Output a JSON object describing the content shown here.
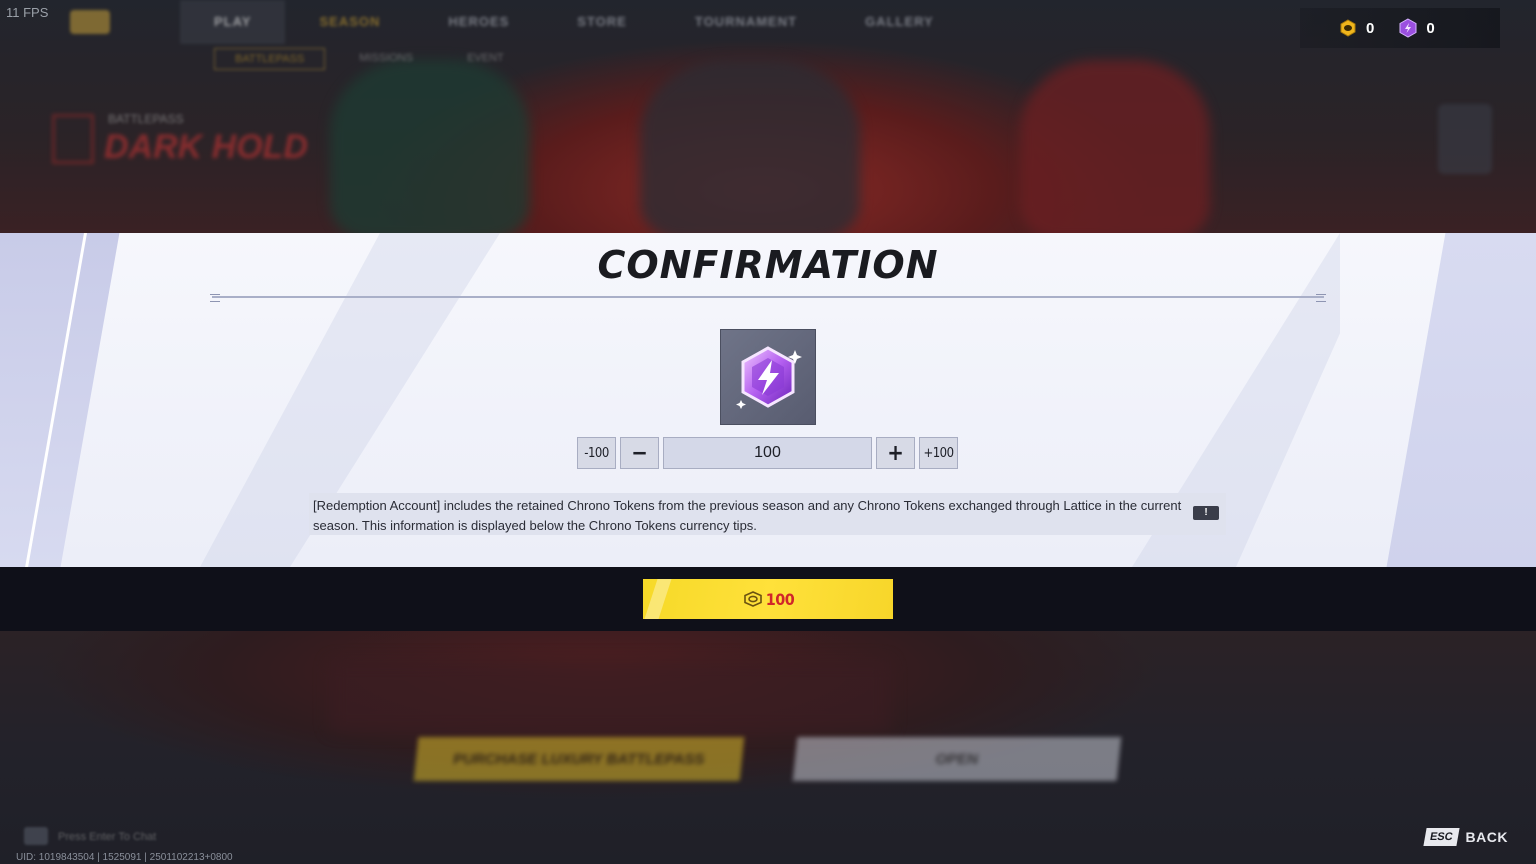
{
  "fps": "11 FPS",
  "background": {
    "nav_tabs": [
      "PLAY",
      "SEASON",
      "HEROES",
      "STORE",
      "TOURNAMENT",
      "GALLERY"
    ],
    "sub_tabs": [
      "BATTLEPASS",
      "MISSIONS",
      "EVENT"
    ],
    "battlepass_label": "BATTLEPASS",
    "battlepass_title": "DARK HOLD",
    "purchase_button": "PURCHASE LUXURY BATTLEPASS",
    "open_button": "OPEN",
    "press_enter": "Press Enter To Chat"
  },
  "currency": {
    "gold_amount": "0",
    "chrono_amount": "0"
  },
  "modal": {
    "title": "CONFIRMATION",
    "item_icon": "chrono-token-icon",
    "quantity": {
      "minus_100": "-100",
      "minus": "−",
      "value": "100",
      "plus": "+",
      "plus_100": "+100"
    },
    "info_text": "[Redemption Account] includes the retained Chrono Tokens from the previous season and any Chrono Tokens exchanged through Lattice in the current season. This information is displayed below the Chrono Tokens currency tips.",
    "info_icon": "!"
  },
  "confirm": {
    "price": "100",
    "price_color": "#d0262a",
    "button_color": "#ffe13a"
  },
  "footer": {
    "uid": "UID: 1019843504 | 1525091 | 2501102213+0800",
    "esc_key": "ESC",
    "back_label": "BACK"
  }
}
